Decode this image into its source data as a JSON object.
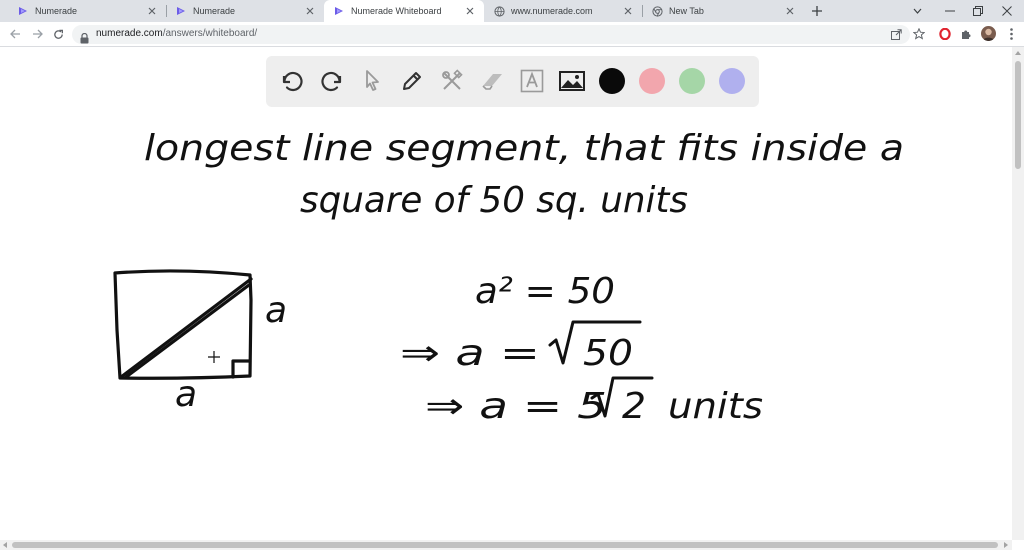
{
  "browser": {
    "tabs": [
      {
        "label": "Numerade",
        "icon": "numerade-logo-icon",
        "active": false
      },
      {
        "label": "Numerade",
        "icon": "numerade-logo-icon",
        "active": false
      },
      {
        "label": "Numerade Whiteboard",
        "icon": "numerade-logo-icon",
        "active": true
      },
      {
        "label": "www.numerade.com",
        "icon": "globe-icon",
        "active": false
      },
      {
        "label": "New Tab",
        "icon": "chrome-icon",
        "active": false
      }
    ],
    "address": {
      "host": "numerade.com",
      "path": "/answers/whiteboard/"
    }
  },
  "whiteboard": {
    "tools": [
      "undo-icon",
      "redo-icon",
      "pointer-icon",
      "pen-icon",
      "tools-icon",
      "eraser-icon",
      "text-icon",
      "image-icon"
    ],
    "colors": [
      "#0a0a0a",
      "#f2a6ad",
      "#a5d6a7",
      "#b0b0ee"
    ],
    "handwriting": {
      "line1": "longest line segment, that fits inside a",
      "line2": "square of 50 sq. units",
      "side_right": "a",
      "side_bottom": "a",
      "eq1": "a² = 50",
      "eq2_lhs": "⇒ a =",
      "eq2_rad": "50",
      "eq3_lhs": "⇒ a = 5",
      "eq3_rad": "2",
      "eq3_unit": "units"
    }
  }
}
